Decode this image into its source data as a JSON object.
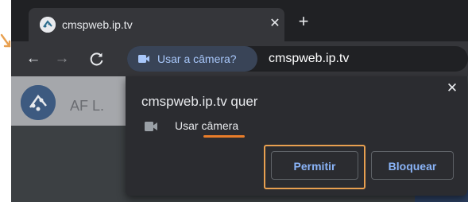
{
  "colors": {
    "accent": "#8ab4f8",
    "annotation": "#e8a050",
    "frame": "#202124",
    "toolbar": "#35363a"
  },
  "tab": {
    "title": "cmspweb.ip.tv",
    "favicon": "site-favicon",
    "close_icon": "close-icon"
  },
  "tabstrip": {
    "new_tab_label": "+"
  },
  "toolbar": {
    "back_label": "←",
    "forward_label": "→",
    "camera_chip_label": "Usar a câmera?",
    "camera_chip_icon": "video-camera-icon",
    "url": "cmspweb.ip.tv"
  },
  "page": {
    "site_name": "AF L."
  },
  "permission_prompt": {
    "title": "cmspweb.ip.tv quer",
    "permission_icon": "video-camera-icon",
    "permission_label": "Usar câmera",
    "close_label": "✕",
    "allow_label": "Permitir",
    "block_label": "Bloquear"
  }
}
